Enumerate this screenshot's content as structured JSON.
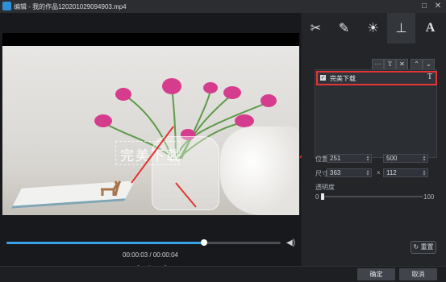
{
  "window": {
    "title": "编辑 - 我的作品120201029094903.mp4"
  },
  "player": {
    "overlay_text": "完美下载",
    "time": "00:00:03 / 00:00:04",
    "progress_fraction": 0.72
  },
  "panel": {
    "tabs": [
      {
        "icon": "scissors-icon",
        "glyph": "✂"
      },
      {
        "icon": "magic-wand-icon",
        "glyph": "✎"
      },
      {
        "icon": "brightness-icon",
        "glyph": "☀"
      },
      {
        "icon": "stamp-icon",
        "glyph": "⊥"
      },
      {
        "icon": "text-icon",
        "glyph": "A"
      }
    ],
    "toolbar": {
      "more": "···",
      "text": "T",
      "delete": "✕",
      "up": "⌃",
      "down": "⌄"
    },
    "list_items": [
      {
        "label": "完美下载",
        "checked": true,
        "type_glyph": "T"
      }
    ],
    "position_label": "位置",
    "position_x": "251",
    "position_y": "500",
    "size_label": "尺寸",
    "size_w": "363",
    "size_h": "112",
    "size_sep": "×",
    "opacity_label": "透明度",
    "opacity_min": "0",
    "opacity_max": "100",
    "opacity_value": 0,
    "reset_label": "重置"
  },
  "footer": {
    "ok": "确定",
    "cancel": "取消"
  },
  "colors": {
    "accent": "#3aa0e8",
    "highlight": "#e23535"
  }
}
